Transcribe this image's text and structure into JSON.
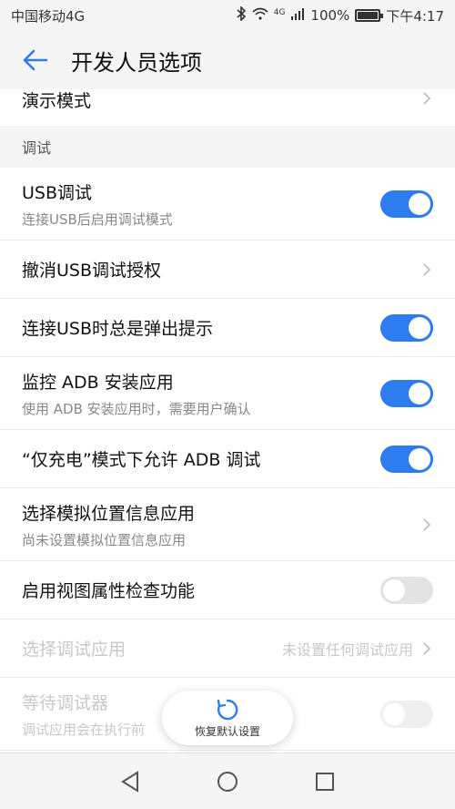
{
  "status_bar": {
    "carrier": "中国移动4G",
    "network_label": "4G",
    "battery_text": "100%",
    "time": "下午4:17",
    "battery_level": 1.0
  },
  "header": {
    "title": "开发人员选项",
    "back_icon": "back-arrow-icon"
  },
  "list": {
    "partial_item": {
      "title": "演示模式"
    },
    "section_title": "调试",
    "items": [
      {
        "title": "USB调试",
        "subtitle": "连接USB后启用调试模式",
        "control": "toggle",
        "on": true
      },
      {
        "title": "撤消USB调试授权",
        "control": "chevron"
      },
      {
        "title": "连接USB时总是弹出提示",
        "control": "toggle",
        "on": true
      },
      {
        "title": "监控 ADB 安装应用",
        "subtitle": "使用 ADB 安装应用时，需要用户确认",
        "control": "toggle",
        "on": true
      },
      {
        "title": "“仅充电”模式下允许 ADB 调试",
        "control": "toggle",
        "on": true
      },
      {
        "title": "选择模拟位置信息应用",
        "subtitle": "尚未设置模拟位置信息应用",
        "control": "chevron"
      },
      {
        "title": "启用视图属性检查功能",
        "control": "toggle",
        "on": false
      },
      {
        "title": "选择调试应用",
        "value": "未设置任何调试应用",
        "control": "chevron",
        "disabled": true
      },
      {
        "title": "等待调试器",
        "subtitle": "调试应用会在执行前",
        "control": "toggle",
        "on": false,
        "disabled": true
      }
    ]
  },
  "fab": {
    "label": "恢复默认设置",
    "icon": "restore-icon"
  },
  "colors": {
    "accent": "#2d7cf0",
    "toggle_off": "#e3e3e3",
    "disabled_text": "#c8c8c8"
  }
}
